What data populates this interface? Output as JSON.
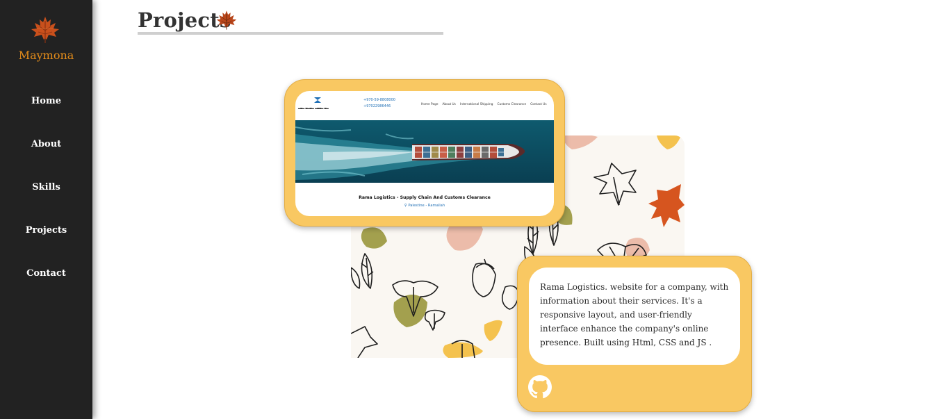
{
  "sidebar": {
    "brand": "Maymona",
    "logo_icon": "maple-leaf-icon",
    "items": [
      {
        "label": "Home"
      },
      {
        "label": "About"
      },
      {
        "label": "Skills"
      },
      {
        "label": "Projects"
      },
      {
        "label": "Contact"
      }
    ]
  },
  "main": {
    "title": "Projects",
    "title_icon": "maple-leaf-icon"
  },
  "project": {
    "screenshot": {
      "phone": "+970-59-8808000",
      "fax": "+97022986446",
      "nav_links": [
        "Home Page",
        "About Us",
        "International Shipping",
        "Customs Clearance",
        "Contact Us"
      ],
      "caption": "Rama Logistics - Supply Chain And Customs Clearance",
      "location": "Palestine - Ramallah"
    },
    "description": "Rama Logistics. website for a company, with information about their services. It's a responsive layout, and user-friendly interface enhance the company's online presence. Built using Html, CSS and JS .",
    "link_icon": "github-icon"
  },
  "colors": {
    "sidebar_bg": "#222222",
    "brand": "#e58d1a",
    "card": "#f9c862",
    "leaf": "#c9501c"
  }
}
